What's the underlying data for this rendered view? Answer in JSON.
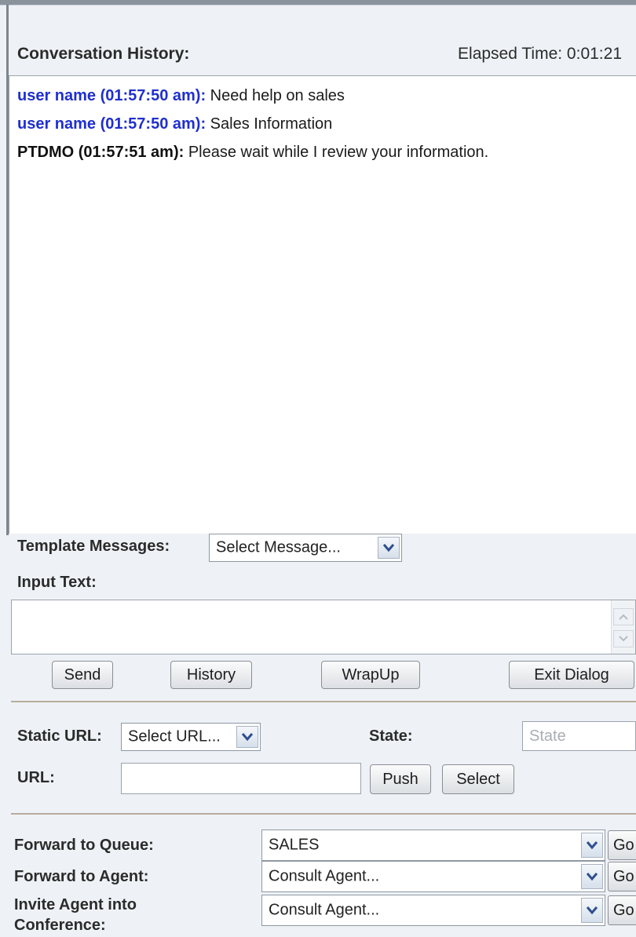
{
  "header": {
    "conversation_history_label": "Conversation History:",
    "elapsed_time": "Elapsed Time: 0:01:21"
  },
  "messages": [
    {
      "sender": "user name (01:57:50 am):",
      "text": " Need help on sales",
      "type": "user"
    },
    {
      "sender": "user name (01:57:50 am):",
      "text": " Sales Information",
      "type": "user"
    },
    {
      "sender": "PTDMO (01:57:51 am):",
      "text": " Please wait while I review your information.",
      "type": "agent"
    }
  ],
  "template": {
    "label": "Template Messages:",
    "selected": "Select Message..."
  },
  "input": {
    "label": "Input Text:",
    "value": ""
  },
  "actions": {
    "send": "Send",
    "history": "History",
    "wrapup": "WrapUp",
    "exit": "Exit Dialog"
  },
  "url_section": {
    "static_url_label": "Static URL:",
    "static_url_selected": "Select URL...",
    "state_label": "State:",
    "state_placeholder": "State",
    "url_label": "URL:",
    "url_value": "",
    "push": "Push",
    "select": "Select"
  },
  "forward": {
    "queue_label": "Forward to Queue:",
    "queue_selected": "SALES",
    "agent_label": "Forward to Agent:",
    "agent_selected": "Consult Agent...",
    "invite_label_line1": "Invite Agent into",
    "invite_label_line2": "Conference:",
    "invite_selected": "Consult Agent...",
    "go": "Go"
  },
  "icons": {
    "dropdown": "chevron-down-icon",
    "scroll_up": "scroll-up-arrow-icon",
    "scroll_down": "scroll-down-arrow-icon"
  }
}
